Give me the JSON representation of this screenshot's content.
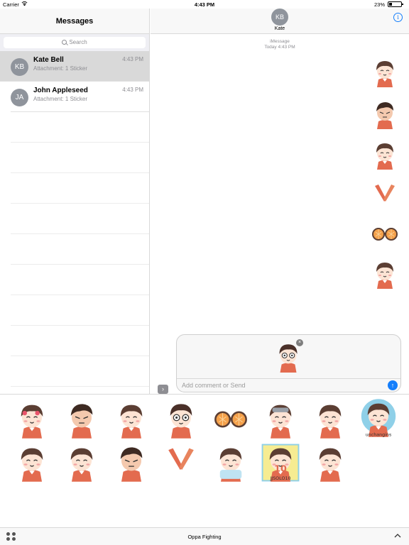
{
  "status_bar": {
    "carrier": "Carrier",
    "time": "4:43 PM",
    "battery": "23%",
    "battery_level": 0.23
  },
  "sidebar": {
    "title": "Messages",
    "search_placeholder": "Search",
    "conversations": [
      {
        "initials": "KB",
        "name": "Kate Bell",
        "preview": "Attachment: 1 Sticker",
        "time": "4:43 PM",
        "selected": true
      },
      {
        "initials": "JA",
        "name": "John Appleseed",
        "preview": "Attachment: 1 Sticker",
        "time": "4:43 PM",
        "selected": false
      }
    ]
  },
  "conversation": {
    "avatar_initials": "KB",
    "contact_name": "Kate",
    "service": "iMessage",
    "timestamp": "Today 4:43 PM",
    "info_icon": "info-icon",
    "expand_icon": "chevron-right-icon",
    "compose_placeholder": "Add comment or Send",
    "send_icon": "arrow-up-icon",
    "remove_icon": "close-icon"
  },
  "drawer": {
    "app_name": "Oppa Fighting",
    "apps_icon": "app-grid-icon",
    "collapse_icon": "chevron-up-icon",
    "sticker_text_1": "unchangins",
    "sticker_text_2": "JJSOLO10",
    "sticker_badge": "10"
  },
  "colors": {
    "accent": "#147efb",
    "avatar": "#8f949c",
    "selected_row": "#d9d9d9",
    "shirt": "#e36b4f",
    "hair": "#5b3e33"
  }
}
